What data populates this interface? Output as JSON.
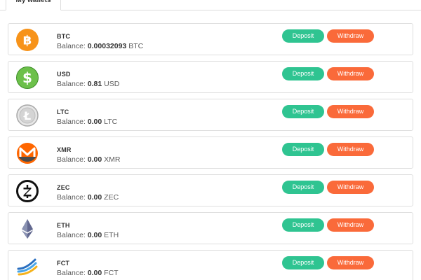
{
  "tabs": {
    "active_label": "My wallets"
  },
  "wallets": [
    {
      "symbol": "BTC",
      "balance_label": "Balance:",
      "amount": "0.00032093",
      "unit": "BTC",
      "icon": "bitcoin-icon",
      "color": "#f7931a"
    },
    {
      "symbol": "USD",
      "balance_label": "Balance:",
      "amount": "0.81",
      "unit": "USD",
      "icon": "dollar-icon",
      "color": "#6cc04a"
    },
    {
      "symbol": "LTC",
      "balance_label": "Balance:",
      "amount": "0.00",
      "unit": "LTC",
      "icon": "litecoin-icon",
      "color": "#b8b8b8"
    },
    {
      "symbol": "XMR",
      "balance_label": "Balance:",
      "amount": "0.00",
      "unit": "XMR",
      "icon": "monero-icon",
      "color": "#ff6600"
    },
    {
      "symbol": "ZEC",
      "balance_label": "Balance:",
      "amount": "0.00",
      "unit": "ZEC",
      "icon": "zcash-icon",
      "color": "#111111"
    },
    {
      "symbol": "ETH",
      "balance_label": "Balance:",
      "amount": "0.00",
      "unit": "ETH",
      "icon": "ethereum-icon",
      "color": "#627eea"
    },
    {
      "symbol": "FCT",
      "balance_label": "Balance:",
      "amount": "0.00",
      "unit": "FCT",
      "icon": "factom-icon",
      "color": "#3a8fd6"
    }
  ],
  "actions": {
    "deposit_label": "Deposit",
    "withdraw_label": "Withdraw"
  },
  "colors": {
    "deposit": "#2fc491",
    "withdraw": "#fa6a3a",
    "border": "#dedede"
  }
}
